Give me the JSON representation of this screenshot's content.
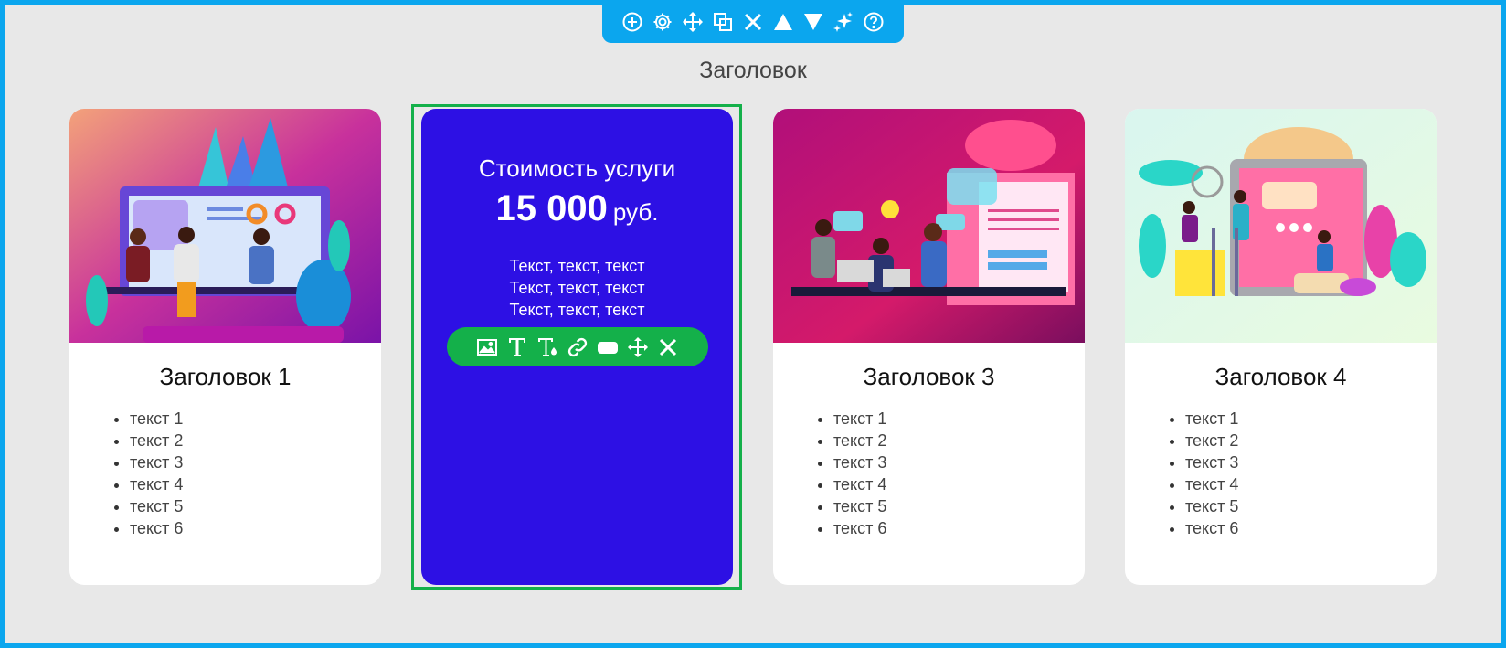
{
  "toolbar": {
    "icons": [
      "add-icon",
      "gear-icon",
      "move-icon",
      "copy-icon",
      "close-icon",
      "arrow-up-icon",
      "arrow-down-icon",
      "sparkle-icon",
      "help-icon"
    ],
    "color": "#0ba6ee"
  },
  "section": {
    "title": "Заголовок"
  },
  "cards": [
    {
      "title": "Заголовок 1",
      "items": [
        "текст 1",
        "текст 2",
        "текст 3",
        "текст 4",
        "текст 5",
        "текст 6"
      ]
    },
    {
      "title": "Заголовок 3",
      "items": [
        "текст 1",
        "текст 2",
        "текст 3",
        "текст 4",
        "текст 5",
        "текст 6"
      ]
    },
    {
      "title": "Заголовок 4",
      "items": [
        "текст 1",
        "текст 2",
        "текст 3",
        "текст 4",
        "текст 5",
        "текст 6"
      ]
    }
  ],
  "price_card": {
    "heading": "Стоимость услуги",
    "amount": "15 000",
    "currency": "руб.",
    "lines": [
      "Текст, текст, текст",
      "Текст, текст, текст",
      "Текст, текст, текст"
    ],
    "background": "#2d10e4"
  },
  "element_toolbar": {
    "icons": [
      "image-icon",
      "text-icon",
      "text-color-icon",
      "link-icon",
      "button-icon",
      "move-icon",
      "close-icon"
    ],
    "color": "#14b04a"
  }
}
